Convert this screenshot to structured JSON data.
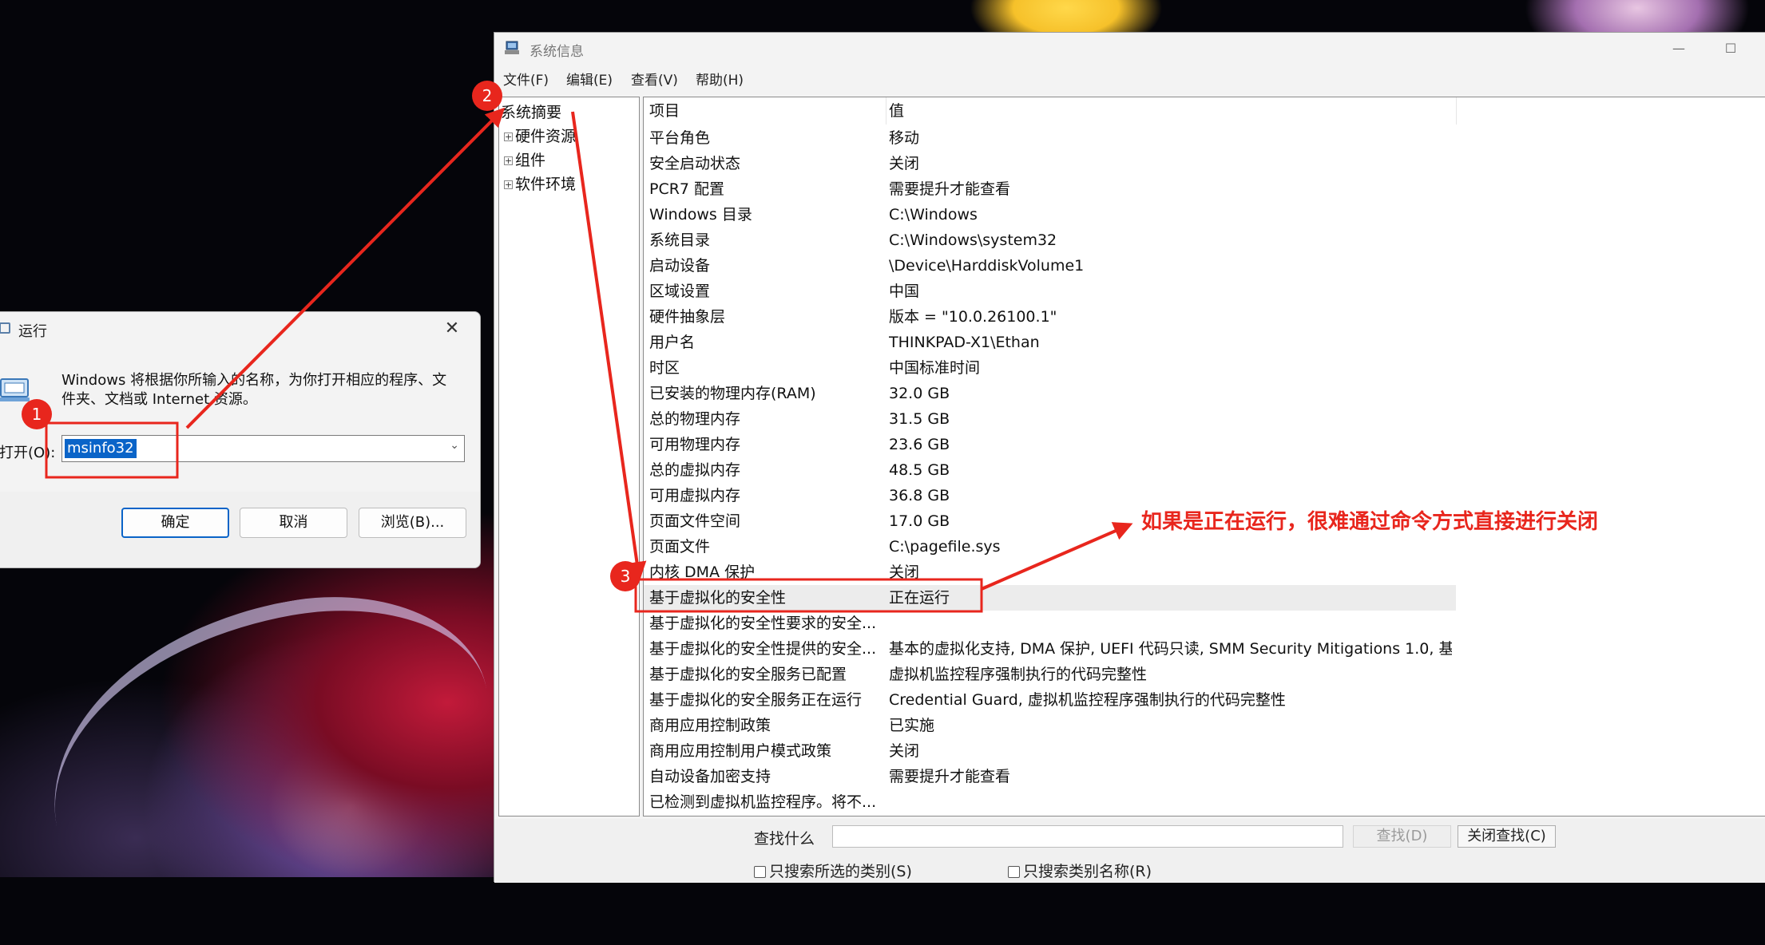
{
  "msinfo": {
    "title": "系统信息",
    "menu": [
      "文件(F)",
      "编辑(E)",
      "查看(V)",
      "帮助(H)"
    ],
    "tree": {
      "root": "系统摘要",
      "children": [
        "硬件资源",
        "组件",
        "软件环境"
      ]
    },
    "columns": [
      "项目",
      "值"
    ],
    "rows": [
      [
        "平台角色",
        "移动"
      ],
      [
        "安全启动状态",
        "关闭"
      ],
      [
        "PCR7 配置",
        "需要提升才能查看"
      ],
      [
        "Windows 目录",
        "C:\\Windows"
      ],
      [
        "系统目录",
        "C:\\Windows\\system32"
      ],
      [
        "启动设备",
        "\\Device\\HarddiskVolume1"
      ],
      [
        "区域设置",
        "中国"
      ],
      [
        "硬件抽象层",
        "版本 = \"10.0.26100.1\""
      ],
      [
        "用户名",
        "THINKPAD-X1\\Ethan"
      ],
      [
        "时区",
        "中国标准时间"
      ],
      [
        "已安装的物理内存(RAM)",
        "32.0 GB"
      ],
      [
        "总的物理内存",
        "31.5 GB"
      ],
      [
        "可用物理内存",
        "23.6 GB"
      ],
      [
        "总的虚拟内存",
        "48.5 GB"
      ],
      [
        "可用虚拟内存",
        "36.8 GB"
      ],
      [
        "页面文件空间",
        "17.0 GB"
      ],
      [
        "页面文件",
        "C:\\pagefile.sys"
      ],
      [
        "内核 DMA 保护",
        "关闭"
      ],
      [
        "基于虚拟化的安全性",
        "正在运行"
      ],
      [
        "基于虚拟化的安全性要求的安全...",
        ""
      ],
      [
        "基于虚拟化的安全性提供的安全...",
        "基本的虚拟化支持, DMA 保护, UEFI 代码只读, SMM Security Mitigations 1.0, 基..."
      ],
      [
        "基于虚拟化的安全服务已配置",
        "虚拟机监控程序强制执行的代码完整性"
      ],
      [
        "基于虚拟化的安全服务正在运行",
        "Credential Guard, 虚拟机监控程序强制执行的代码完整性"
      ],
      [
        "商用应用控制政策",
        "已实施"
      ],
      [
        "商用应用控制用户模式政策",
        "关闭"
      ],
      [
        "自动设备加密支持",
        "需要提升才能查看"
      ],
      [
        "已检测到虚拟机监控程序。将不...",
        ""
      ]
    ],
    "selected_row": 18,
    "find": {
      "label": "查找什么",
      "value": "",
      "find_button": "查找(D)",
      "close_button": "关闭查找(C)",
      "checkbox_selected_category": "只搜索所选的类别(S)",
      "checkbox_category_names": "只搜索类别名称(R)"
    }
  },
  "run": {
    "title": "运行",
    "description": "Windows 将根据你所输入的名称，为你打开相应的程序、文件夹、文档或 Internet 资源。",
    "open_label": "打开(O):",
    "input_value": "msinfo32",
    "buttons": [
      "确定",
      "取消",
      "浏览(B)..."
    ]
  },
  "annotations": {
    "badges": [
      "1",
      "2",
      "3"
    ],
    "callout": "如果是正在运行，很难通过命令方式直接进行关闭",
    "color": "#e8261d"
  }
}
